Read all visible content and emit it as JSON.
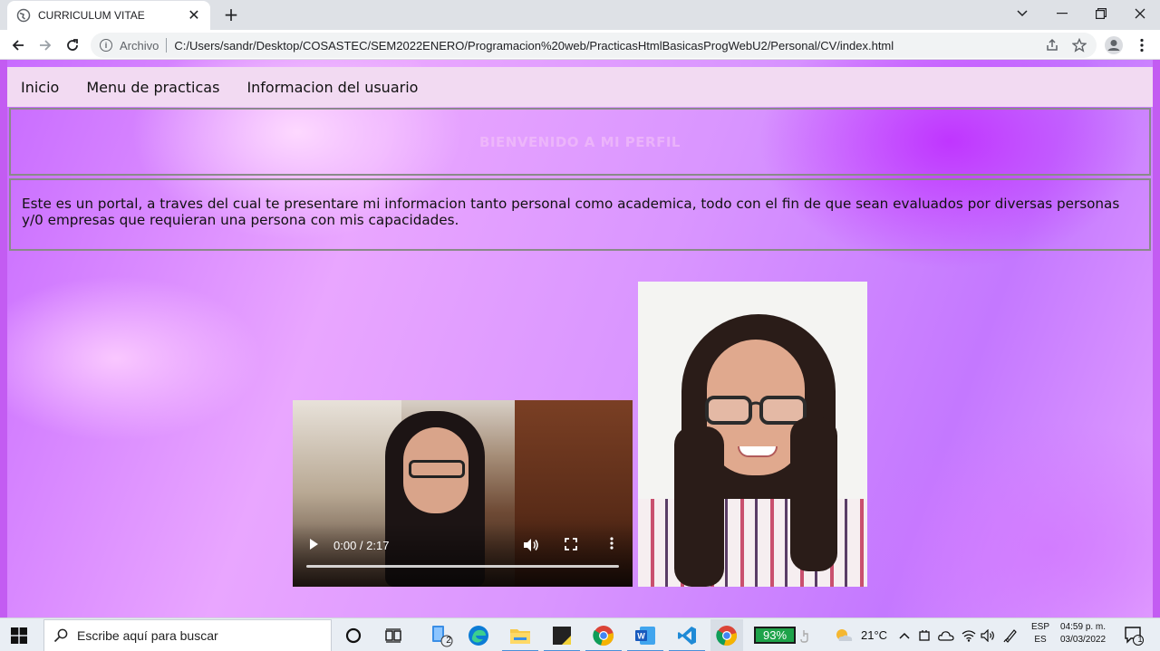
{
  "browser": {
    "tab_title": "CURRICULUM VITAE",
    "tab_close": "✕",
    "new_tab": "+",
    "site_info_label": "Archivo",
    "url": "C:/Users/sandr/Desktop/COSASTEC/SEM2022ENERO/Programacion%20web/PracticasHtmlBasicasProgWebU2/Personal/CV/index.html",
    "icons": [
      "globe-icon",
      "back-icon",
      "forward-icon",
      "reload-icon",
      "info-icon",
      "share-icon",
      "star-icon",
      "profile-icon",
      "menu-icon",
      "tab-search-icon",
      "minimize-icon",
      "restore-icon",
      "close-icon"
    ]
  },
  "page": {
    "nav": [
      "Inicio",
      "Menu de practicas",
      "Informacion del usuario"
    ],
    "banner_title": "BIENVENIDO A MI PERFIL",
    "intro": "Este es un portal, a traves del cual te presentare mi informacion tanto personal como academica, todo con el fin de que sean evaluados por diversas personas y/0 empresas que requieran una persona con mis capacidades.",
    "video": {
      "time": "0:00 / 2:17",
      "progress": 0
    }
  },
  "taskbar": {
    "search_placeholder": "Escribe aquí para buscar",
    "explorer_badge": "2",
    "battery": "93%",
    "temperature": "21°C",
    "lang_top": "ESP",
    "lang_bottom": "ES",
    "time": "04:59 p. m.",
    "date": "03/03/2022",
    "notification_count": "1"
  },
  "colors": {
    "page_border": "#c35cf2",
    "nav_bg": "#f2daf2",
    "battery_bg": "#1ea34a",
    "taskbar_bg": "#e9eef4"
  }
}
